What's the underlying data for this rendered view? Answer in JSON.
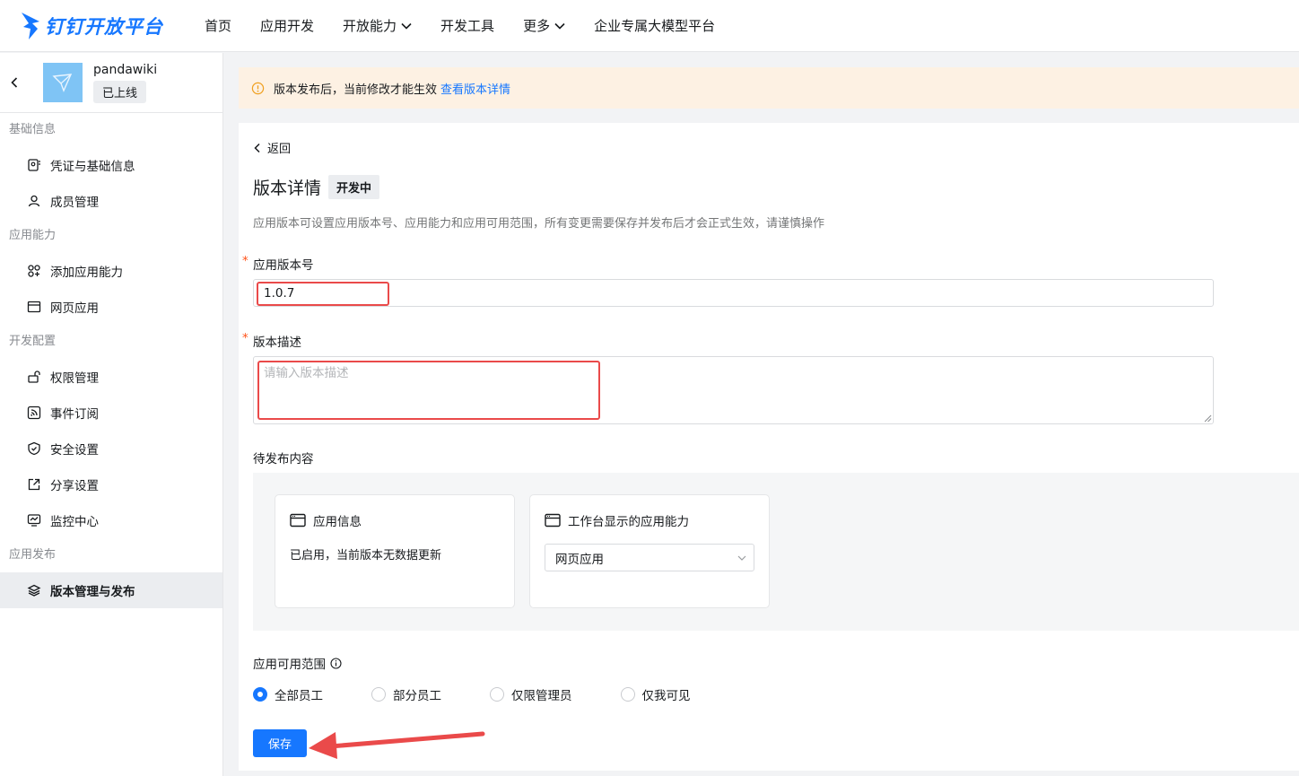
{
  "topnav": {
    "logo_text": "钉钉开放平台",
    "items": [
      {
        "label": "首页",
        "has_dropdown": false
      },
      {
        "label": "应用开发",
        "has_dropdown": false
      },
      {
        "label": "开放能力",
        "has_dropdown": true
      },
      {
        "label": "开发工具",
        "has_dropdown": false
      },
      {
        "label": "更多",
        "has_dropdown": true
      },
      {
        "label": "企业专属大模型平台",
        "has_dropdown": false
      }
    ]
  },
  "sidebar": {
    "app_name": "pandawiki",
    "app_status": "已上线",
    "groups": [
      {
        "title": "基础信息",
        "items": [
          {
            "label": "凭证与基础信息",
            "icon": "credential-icon"
          },
          {
            "label": "成员管理",
            "icon": "user-icon"
          }
        ]
      },
      {
        "title": "应用能力",
        "items": [
          {
            "label": "添加应用能力",
            "icon": "apps-icon"
          },
          {
            "label": "网页应用",
            "icon": "browser-icon"
          }
        ]
      },
      {
        "title": "开发配置",
        "items": [
          {
            "label": "权限管理",
            "icon": "unlock-icon"
          },
          {
            "label": "事件订阅",
            "icon": "rss-icon"
          },
          {
            "label": "安全设置",
            "icon": "shield-icon"
          },
          {
            "label": "分享设置",
            "icon": "share-icon"
          },
          {
            "label": "监控中心",
            "icon": "monitor-icon"
          }
        ]
      },
      {
        "title": "应用发布",
        "items": [
          {
            "label": "版本管理与发布",
            "icon": "layers-icon",
            "active": true
          }
        ]
      }
    ]
  },
  "notice": {
    "text": "版本发布后，当前修改才能生效",
    "link": "查看版本详情"
  },
  "detail": {
    "back_label": "返回",
    "title": "版本详情",
    "badge": "开发中",
    "description": "应用版本可设置应用版本号、应用能力和应用可用范围，所有变更需要保存并发布后才会正式生效，请谨慎操作",
    "version_label": "应用版本号",
    "version_value": "1.0.7",
    "desc_label": "版本描述",
    "desc_placeholder": "请输入版本描述",
    "pending_label": "待发布内容",
    "card_info_title": "应用信息",
    "card_info_text": "已启用，当前版本无数据更新",
    "card_ability_title": "工作台显示的应用能力",
    "card_ability_select": "网页应用",
    "scope_label": "应用可用范围",
    "scope_options": [
      {
        "label": "全部员工",
        "selected": true
      },
      {
        "label": "部分员工",
        "selected": false
      },
      {
        "label": "仅限管理员",
        "selected": false
      },
      {
        "label": "仅我可见",
        "selected": false
      }
    ],
    "save_label": "保存"
  },
  "colors": {
    "accent": "#1677ff",
    "notice_bg": "#fdf1e3",
    "annotation_red": "#ea4a4a"
  }
}
